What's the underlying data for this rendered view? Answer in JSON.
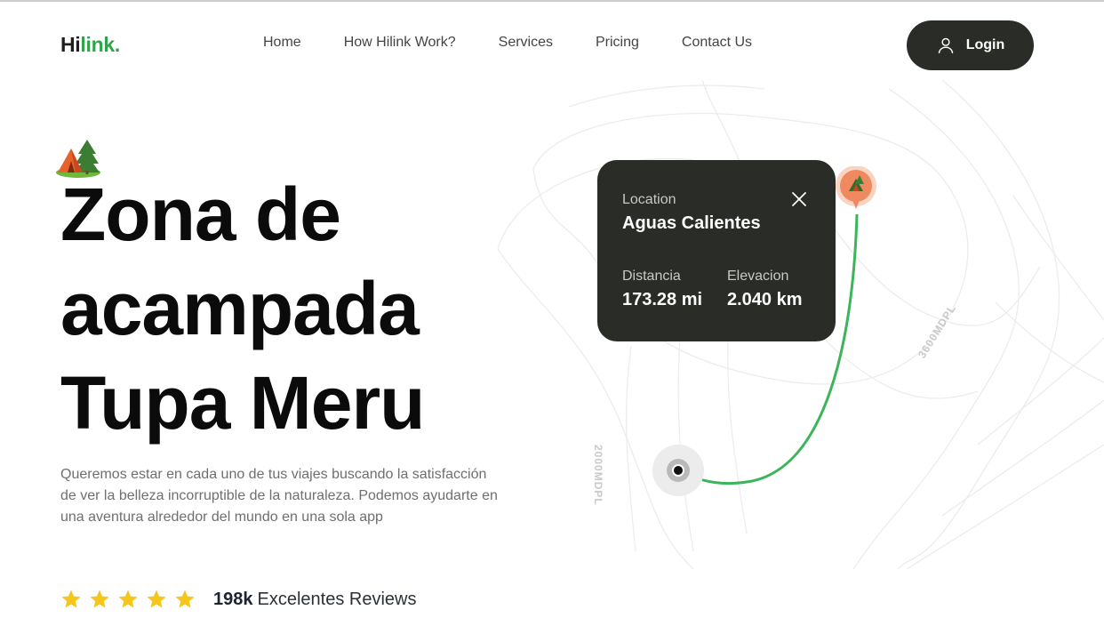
{
  "brand": {
    "part1": "Hi",
    "part2": "link.",
    "accent": "#2fa54b"
  },
  "nav": {
    "items": [
      {
        "label": "Home"
      },
      {
        "label": "How Hilink Work?"
      },
      {
        "label": "Services"
      },
      {
        "label": "Pricing"
      },
      {
        "label": "Contact Us"
      }
    ],
    "login_label": "Login"
  },
  "hero": {
    "title_lines": [
      "Zona de",
      "acampada",
      "Tupa Meru"
    ],
    "description": "Queremos estar en cada uno de tus viajes buscando la satisfacción de ver la belleza incorruptible de la naturaleza. Podemos ayudarte en una aventura alrededor del mundo en una sola app",
    "rating": {
      "stars": 5,
      "count": "198k",
      "label": "Excelentes Reviews",
      "star_color": "#f5c518"
    }
  },
  "map": {
    "contour_labels": [
      "2000MDPL",
      "3600MDPL"
    ],
    "card": {
      "location_label": "Location",
      "location_name": "Aguas Calientes",
      "distance_label": "Distancia",
      "distance_value": "173.28 mi",
      "elevation_label": "Elevacion",
      "elevation_value": "2.040 km"
    },
    "route_color": "#3cb45a",
    "pin_color": "#f0895f"
  },
  "icons": {
    "camp": "camp-icon",
    "user": "user-icon",
    "close": "close-icon",
    "star": "star-icon"
  },
  "colors": {
    "dark": "#292c27"
  }
}
